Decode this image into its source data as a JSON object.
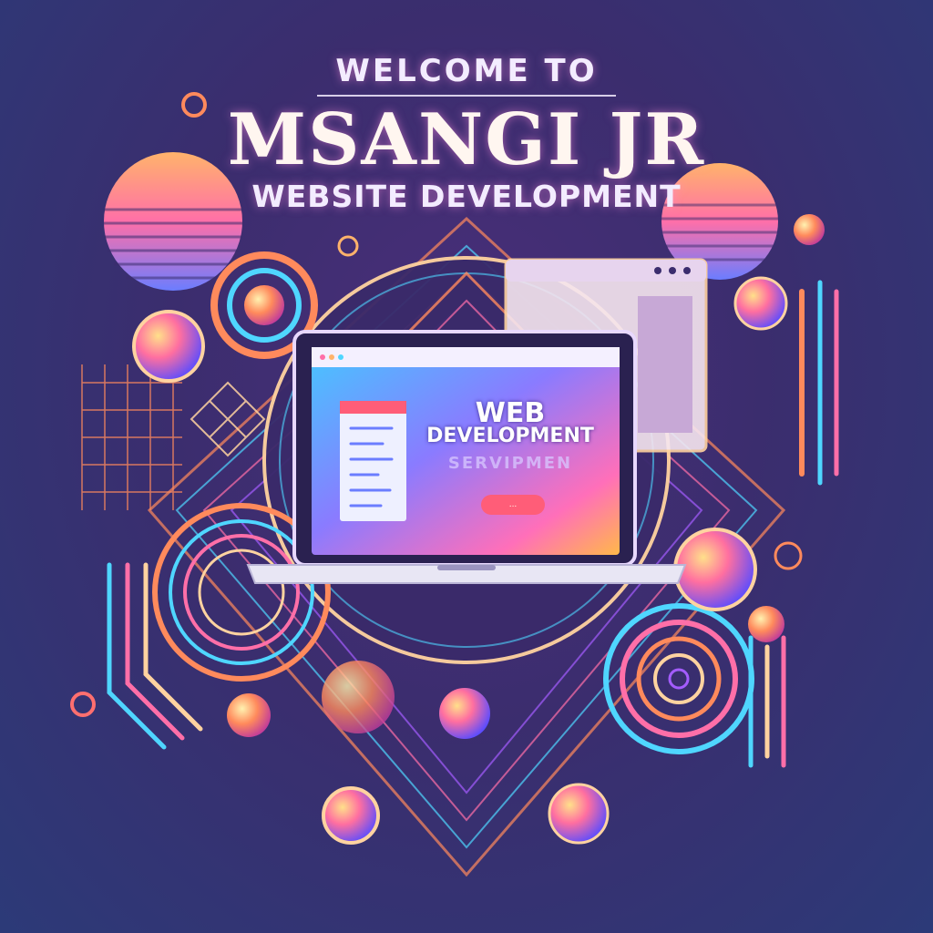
{
  "header": {
    "welcome": "WELCOME TO",
    "brand": "MSANGI JR",
    "subtitle": "WEBSITE DEVELOPMENT"
  },
  "laptop_screen": {
    "line1": "WEB",
    "line2": "DEVELOPMENT",
    "line3": "SERVIPMEN",
    "cta_label": "..."
  },
  "colors": {
    "background_top": "#4a2f7a",
    "background_bottom": "#2c3a78",
    "accent_pink": "#ff5d78",
    "accent_orange": "#ff9a4a",
    "accent_cyan": "#4fd6ff",
    "accent_violet": "#a45cff"
  },
  "icons": [
    "laptop-icon",
    "browser-window-icon",
    "orb-icon",
    "concentric-ring-icon",
    "grid-pattern-icon"
  ]
}
